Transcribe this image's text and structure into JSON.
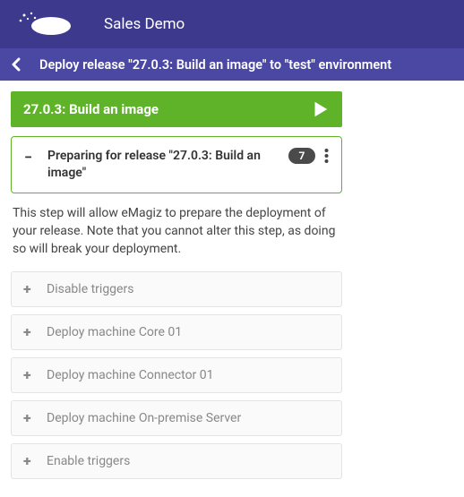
{
  "header": {
    "app_title": "Sales Demo"
  },
  "subheader": {
    "title": "Deploy release \"27.0.3: Build an image\" to \"test\" environment"
  },
  "release": {
    "title": "27.0.3: Build an image"
  },
  "active_card": {
    "toggle": "−",
    "label": "Preparing for release \"27.0.3: Build an image\"",
    "badge": "7",
    "description": "This step will allow eMagiz to prepare the deployment of your release. Note that you cannot alter this step, as doing so will break your deployment."
  },
  "steps": [
    {
      "toggle": "+",
      "label": "Disable triggers"
    },
    {
      "toggle": "+",
      "label": "Deploy machine Core 01"
    },
    {
      "toggle": "+",
      "label": "Deploy machine Connector 01"
    },
    {
      "toggle": "+",
      "label": "Deploy machine On-premise Server"
    },
    {
      "toggle": "+",
      "label": "Enable triggers"
    }
  ]
}
